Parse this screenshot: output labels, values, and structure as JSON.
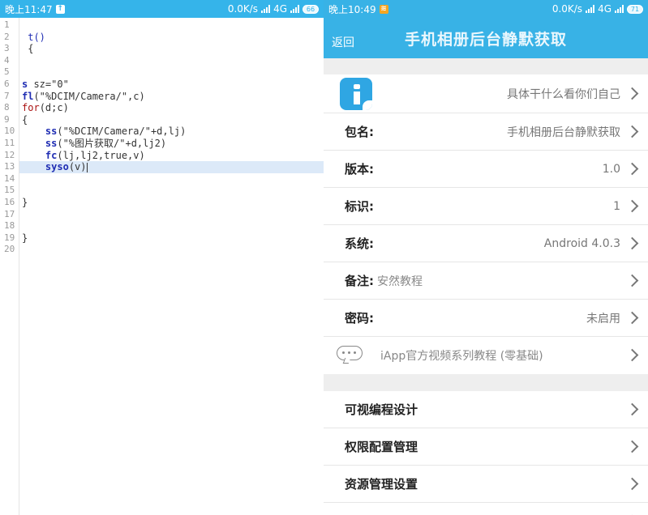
{
  "left": {
    "status": {
      "time": "晚上11:47",
      "net": "0.0K/s",
      "network": "4G",
      "battery": "66"
    },
    "line_numbers": [
      "1",
      "2",
      "3",
      "4",
      "5",
      "6",
      "7",
      "8",
      "9",
      "10",
      "11",
      "12",
      "13",
      "14",
      "15",
      "16",
      "17",
      "18",
      "19",
      "20"
    ],
    "code": {
      "l2": "t()",
      "l3": "{",
      "l6_kw": "s",
      "l6_rest": " sz=\"0\"",
      "l7_kw": "fl",
      "l7_rest": "(\"%DCIM/Camera/\",c)",
      "l8_kw": "for",
      "l8_rest": "(d;c)",
      "l9": "{",
      "l10_kw": "ss",
      "l10_rest": "(\"%DCIM/Camera/\"+d,lj)",
      "l11_kw": "ss",
      "l11_rest": "(\"%图片获取/\"+d,lj2)",
      "l12_kw": "fc",
      "l12_rest": "(lj,lj2,true,v)",
      "l13_kw": "syso",
      "l13_rest": "(v)",
      "l16": "}",
      "l19": "}"
    }
  },
  "right": {
    "status": {
      "time": "晚上10:49",
      "net": "0.0K/s",
      "network": "4G",
      "battery": "71"
    },
    "header": {
      "back_label": "返回",
      "title": "手机相册后台静默获取"
    },
    "info": {
      "desc": "具体干什么看你们自己",
      "rows": [
        {
          "label": "包名:",
          "value": "手机相册后台静默获取"
        },
        {
          "label": "版本:",
          "value": "1.0"
        },
        {
          "label": "标识:",
          "value": "1"
        },
        {
          "label": "系统:",
          "value": "Android 4.0.3"
        }
      ],
      "remark_label": "备注:",
      "remark_value": "安然教程",
      "password_label": "密码:",
      "password_value": "未启用",
      "video_text": "iApp官方视频系列教程 (零基础)"
    },
    "menu": [
      {
        "label": "可视编程设计"
      },
      {
        "label": "权限配置管理"
      },
      {
        "label": "资源管理设置"
      }
    ]
  },
  "colors": {
    "accent": "#38b2e6",
    "keyword": "#1f2db3",
    "highlight": "#dce9f8"
  }
}
